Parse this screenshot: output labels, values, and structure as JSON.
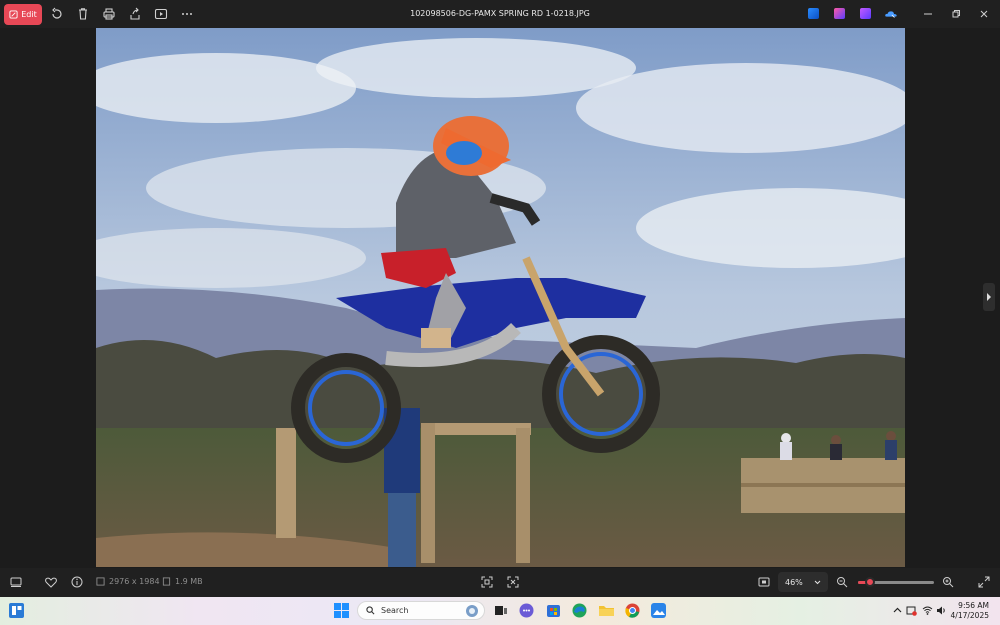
{
  "toolbar": {
    "edit_label": "Edit",
    "file_title": "102098506-DG-PAMX SPRING RD 1-0218.JPG"
  },
  "image_info": {
    "dimensions": "2976 x 1984",
    "file_size": "1.9 MB"
  },
  "zoom": {
    "level_label": "46%",
    "slider_fraction": 0.1
  },
  "taskbar": {
    "search_placeholder": "Search",
    "time": "9:56 AM",
    "date": "4/17/2025"
  },
  "colors": {
    "accent": "#e74856",
    "topbar": "#202020",
    "viewer_bg": "#1c1c1c"
  }
}
